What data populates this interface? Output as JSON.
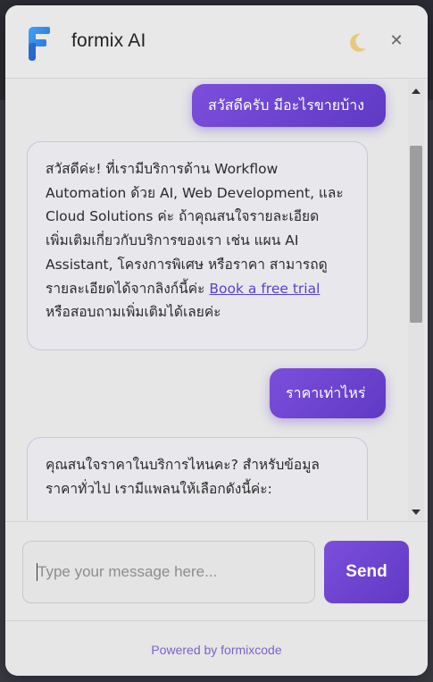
{
  "header": {
    "brand_name": "formix AI",
    "logo_icon": "formix-f-logo",
    "theme_toggle_icon": "moon-icon",
    "close_icon": "close-icon",
    "close_glyph": "✕"
  },
  "conversation": {
    "messages": [
      {
        "role": "user",
        "text": "สวัสดีครับ มีอะไรขายบ้าง"
      },
      {
        "role": "assistant",
        "lines": [
          "สวัสดีค่ะ! ที่เรามีบริการด้าน Workflow",
          "Automation ด้วย AI, Web Development, และ",
          "Cloud Solutions ค่ะ ถ้าคุณสนใจรายละเอียด",
          "เพิ่มเติมเกี่ยวกับบริการของเรา เช่น แผน AI",
          "Assistant, โครงการพิเศษ หรือราคา สามารถดู",
          "รายละเอียดได้จากลิงก์นี้ค่ะ"
        ],
        "link_text": "Book a free trial",
        "tail": "หรือสอบถามเพิ่มเติมได้เลยค่ะ"
      },
      {
        "role": "user",
        "text": "ราคาเท่าไหร่"
      },
      {
        "role": "assistant",
        "lines": [
          "คุณสนใจราคาในบริการไหนคะ? สำหรับข้อมูล",
          "ราคาทั่วไป เรามีแพลนให้เลือกดังนี้ค่ะ:"
        ]
      }
    ]
  },
  "composer": {
    "input_value": "",
    "placeholder": "Type your message here...",
    "send_label": "Send"
  },
  "footer": {
    "powered_by": "Powered by formixcode"
  },
  "colors": {
    "accent": "#6a44d4",
    "accent_dark": "#5f39c4",
    "widget_bg": "#e6e6e6",
    "link": "#5a3fd0",
    "moon": "#e8c97a"
  }
}
